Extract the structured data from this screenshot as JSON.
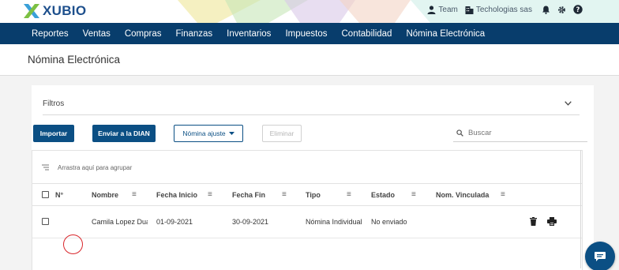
{
  "header": {
    "brand": "XUBIO",
    "team_label": "Team",
    "company_label": "Techologias sas",
    "accent": "#083d6c"
  },
  "nav": {
    "items": [
      "Reportes",
      "Ventas",
      "Compras",
      "Finanzas",
      "Inventarios",
      "Impuestos",
      "Contabilidad",
      "Nómina Electrónica"
    ]
  },
  "page": {
    "title": "Nómina Electrónica"
  },
  "filters": {
    "label": "Filtros"
  },
  "toolbar": {
    "import_label": "Importar",
    "send_label": "Enviar a la DIAN",
    "ajuste_label": "Nómina ajuste",
    "delete_label": "Eliminar",
    "search_placeholder": "Buscar"
  },
  "grid": {
    "group_hint": "Arrastra aquí para agrupar",
    "columns": [
      "N°",
      "Nombre",
      "Fecha Inicio",
      "Fecha Fin",
      "Tipo",
      "Estado",
      "Nom. Vinculada"
    ],
    "rows": [
      {
        "numero": "",
        "nombre": "Camila Lopez Duarte",
        "fecha_inicio": "01-09-2021",
        "fecha_fin": "30-09-2021",
        "tipo": "Nómina Individual",
        "estado": "No enviado",
        "vinculada": ""
      }
    ]
  },
  "icons": {
    "logo": "xubio-x-logo",
    "team": "person-icon",
    "company": "building-icon",
    "notifications": "bell-icon",
    "settings": "gear-icon",
    "help": "help-icon",
    "chevron": "chevron-down-icon",
    "search": "search-icon",
    "delete": "trash-icon",
    "print": "printer-icon",
    "chat": "chat-icon"
  }
}
